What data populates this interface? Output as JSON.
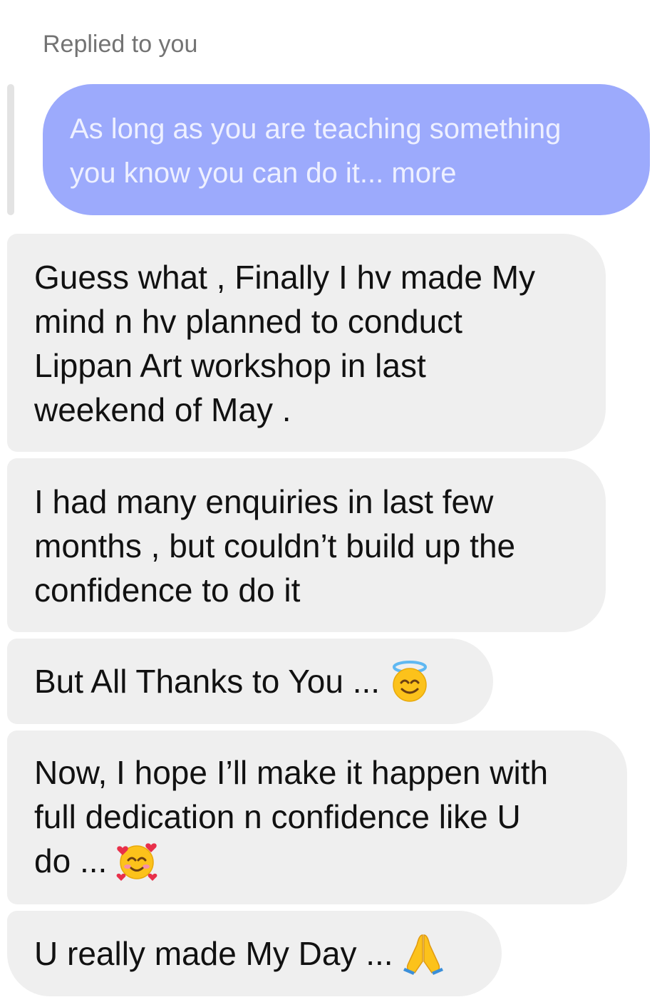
{
  "reply": {
    "label": "Replied to you",
    "quoted_line_1": "As long as you are teaching something",
    "quoted_line_2": "you know you can do it... more"
  },
  "messages": [
    {
      "lines": [
        "Guess what , Finally I hv made My",
        "mind n hv planned to conduct",
        "Lippan Art workshop in last",
        "weekend of May ."
      ]
    },
    {
      "lines": [
        "I had many enquiries in last few",
        "months , but couldn’t build up the",
        "confidence to do it"
      ]
    },
    {
      "lines": [
        "But All Thanks to You ..."
      ],
      "emoji": "smiling-face-with-halo-icon"
    },
    {
      "lines": [
        "Now, I hope I’ll make it happen with",
        "full dedication n confidence like U",
        "do ..."
      ],
      "emoji": "smiling-face-with-hearts-icon"
    },
    {
      "lines": [
        "U really made My Day ..."
      ],
      "emoji": "folded-hands-icon"
    }
  ],
  "colors": {
    "quoted_bubble": "#9caafc",
    "incoming_bubble": "#efefef",
    "reply_label": "#737373"
  }
}
